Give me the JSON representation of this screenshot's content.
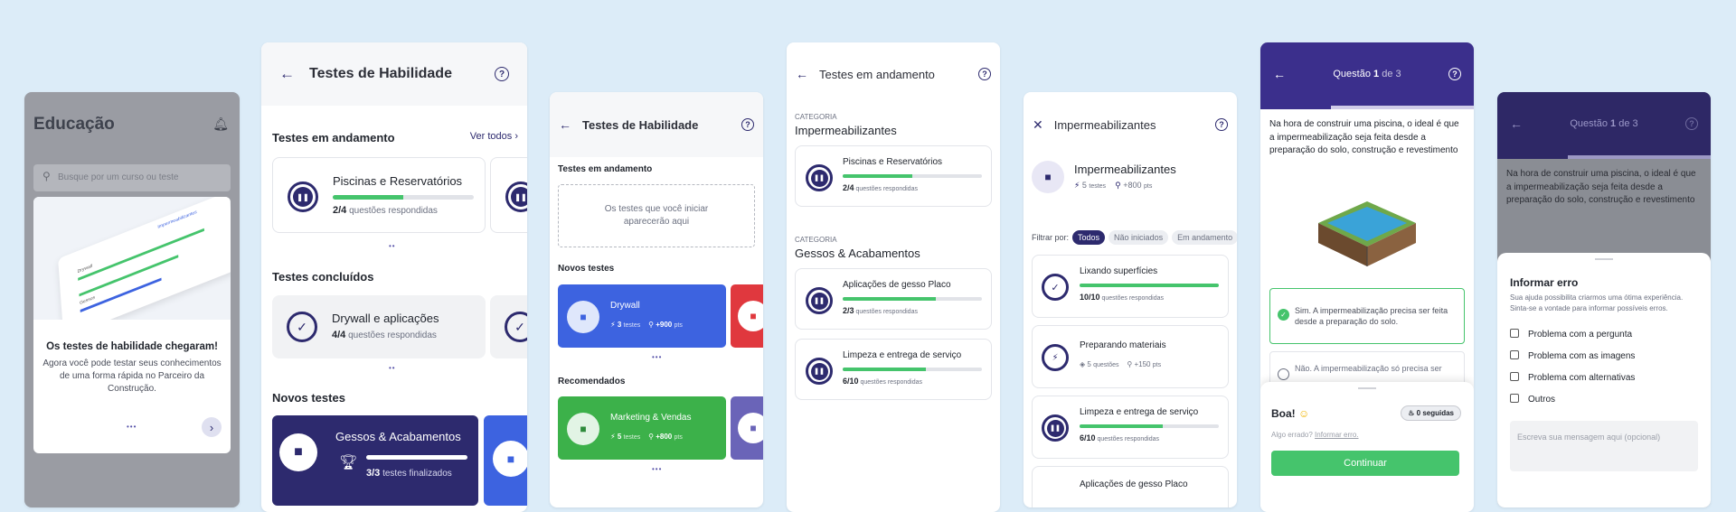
{
  "colors": {
    "primary": "#2d2a6e",
    "green": "#45c46c",
    "blue": "#3d63e0",
    "red": "#e0383e",
    "bg": "#dcecf8"
  },
  "screen1": {
    "title": "Educação",
    "search_placeholder": "Busque por um curso ou teste",
    "modal_title": "Os testes de habilidade chegaram!",
    "modal_text": "Agora você pode testar seus conhecimentos de uma forma rápida no Parceiro da Construção.",
    "illus_label": "Impermeabilizantes",
    "illus_label2": "Drywall",
    "illus_label3": "Gessos"
  },
  "screen2": {
    "title": "Testes de Habilidade",
    "in_progress": "Testes em andamento",
    "see_all": "Ver todos",
    "card1_title": "Piscinas e Reservatórios",
    "card1_count": "2/4",
    "card1_sub": "questões respondidas",
    "card1_progress": 0.5,
    "done": "Testes concluídos",
    "card2_title": "Drywall e aplicações",
    "card2_count": "4/4",
    "card2_sub": "questões respondidas",
    "new_tests": "Novos testes",
    "card3_title": "Gessos & Acabamentos",
    "card3_count": "3/3",
    "card3_sub": "testes finalizados"
  },
  "screen3": {
    "title": "Testes de Habilidade",
    "in_progress": "Testes em andamento",
    "empty_text": "Os testes que você iniciar aparecerão aqui",
    "new_tests": "Novos testes",
    "drywall": "Drywall",
    "drywall_tests": "3",
    "drywall_tests_label": "testes",
    "drywall_pts": "+900",
    "pts": "pts",
    "recommended": "Recomendados",
    "marketing": "Marketing & Vendas",
    "marketing_tests": "5",
    "marketing_pts": "+800"
  },
  "screen4": {
    "title": "Testes em andamento",
    "category_label": "CATEGORIA",
    "cat1": "Impermeabilizantes",
    "t1": "Piscinas e Reservatórios",
    "t1_count": "2/4",
    "t1_progress": 0.5,
    "sub": "questões respondidas",
    "cat2": "Gessos & Acabamentos",
    "t2": "Aplicações de gesso Placo",
    "t2_count": "2/3",
    "t2_progress": 0.67,
    "t3": "Limpeza e entrega de serviço",
    "t3_count": "6/10",
    "t3_progress": 0.6
  },
  "screen5": {
    "title": "Impermeabilizantes",
    "hero_title": "Impermeabilizantes",
    "hero_tests": "5",
    "hero_tests_label": "testes",
    "hero_pts": "+800",
    "pts": "pts",
    "filter_label": "Filtrar por:",
    "filters": [
      "Todos",
      "Não iniciados",
      "Em andamento"
    ],
    "i1": "Lixando superfícies",
    "i1_count": "10/10",
    "i1_progress": 1.0,
    "sub": "questões respondidas",
    "i2": "Preparando materiais",
    "i2_q": "5",
    "i2_q_label": "questões",
    "i2_pts": "+150",
    "i3": "Limpeza e entrega de serviço",
    "i3_count": "6/10",
    "i3_progress": 0.6,
    "i4": "Aplicações de gesso Placo"
  },
  "screen6": {
    "q_label": "Questão",
    "q_num": "1",
    "q_of": "de 3",
    "question": "Na hora de construir uma piscina, o ideal é que a impermeabilização seja feita desde a preparação do solo, construção e revestimento",
    "answer1": "Sim. A impermeabilização precisa ser feita desde a preparação do solo.",
    "answer2": "Não. A impermeabilização só precisa ser",
    "feedback_title": "Boa!",
    "streak": "0 seguidas",
    "error_prompt": "Algo errado?",
    "error_link": "Informar erro.",
    "continue": "Continuar"
  },
  "screen7": {
    "q_label": "Questão",
    "q_num": "1",
    "q_of": "de 3",
    "question": "Na hora de construir uma piscina, o ideal é que a impermeabilização seja feita desde a preparação do solo, construção e revestimento",
    "sheet_title": "Informar erro",
    "sheet_text": "Sua ajuda possibilita criarmos uma ótima experiência. Sinta-se a vontade para informar possíveis erros.",
    "options": [
      "Problema com a pergunta",
      "Problema com as imagens",
      "Problema com alternativas",
      "Outros"
    ],
    "textarea_placeholder": "Escreva sua mensagem aqui (opcional)"
  }
}
